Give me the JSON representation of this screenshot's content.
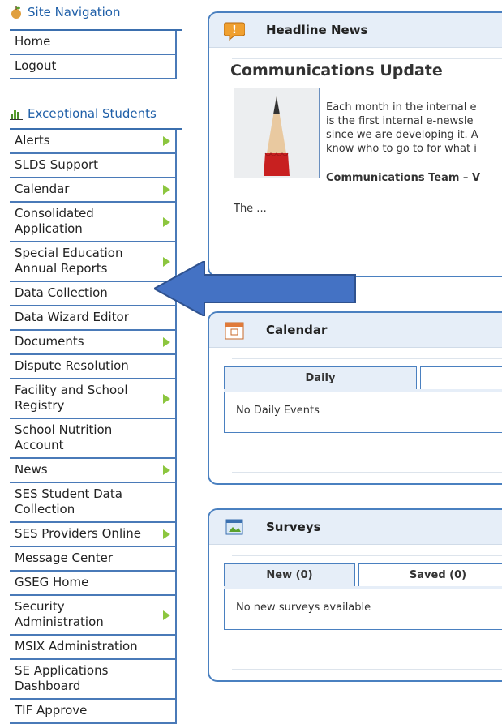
{
  "sidebar": {
    "site_nav_title": "Site Navigation",
    "site_nav_items": [
      {
        "label": "Home",
        "has_submenu": false
      },
      {
        "label": "Logout",
        "has_submenu": false
      }
    ],
    "section_title": "Exceptional Students",
    "items": [
      {
        "label": "Alerts",
        "has_submenu": true
      },
      {
        "label": "SLDS Support",
        "has_submenu": false
      },
      {
        "label": "Calendar",
        "has_submenu": true
      },
      {
        "label": "Consolidated Application",
        "has_submenu": true
      },
      {
        "label": "Special Education Annual Reports",
        "has_submenu": true
      },
      {
        "label": "Data Collection",
        "has_submenu": false
      },
      {
        "label": "Data Wizard Editor",
        "has_submenu": false
      },
      {
        "label": "Documents",
        "has_submenu": true
      },
      {
        "label": "Dispute Resolution",
        "has_submenu": false
      },
      {
        "label": "Facility and School Registry",
        "has_submenu": true
      },
      {
        "label": "School Nutrition Account",
        "has_submenu": false
      },
      {
        "label": "News",
        "has_submenu": true
      },
      {
        "label": "SES Student Data Collection",
        "has_submenu": false
      },
      {
        "label": "SES Providers Online",
        "has_submenu": true
      },
      {
        "label": "Message Center",
        "has_submenu": false
      },
      {
        "label": "GSEG Home",
        "has_submenu": false
      },
      {
        "label": "Security Administration",
        "has_submenu": true
      },
      {
        "label": "MSIX Administration",
        "has_submenu": false
      },
      {
        "label": "SE Applications Dashboard",
        "has_submenu": false
      },
      {
        "label": "TIF Approve",
        "has_submenu": false
      }
    ]
  },
  "news": {
    "title": "Headline News",
    "article_title": "Communications Update",
    "lines": [
      "Each month in the internal e",
      "is the first internal e-newsle",
      "since we are developing it. A",
      "know who to go to for what i"
    ],
    "signature": "Communications Team – V",
    "more": "The ..."
  },
  "calendar": {
    "title": "Calendar",
    "tabs": [
      "Daily",
      ""
    ],
    "empty_text": "No Daily Events"
  },
  "surveys": {
    "title": "Surveys",
    "tabs": [
      "New (0)",
      "Saved (0)"
    ],
    "empty_text": "No new surveys available"
  },
  "colors": {
    "accent": "#3b6fae",
    "arrow": "#4472c4",
    "submenu_arrow": "#8cc63f",
    "panel_header": "#e6eef8"
  }
}
